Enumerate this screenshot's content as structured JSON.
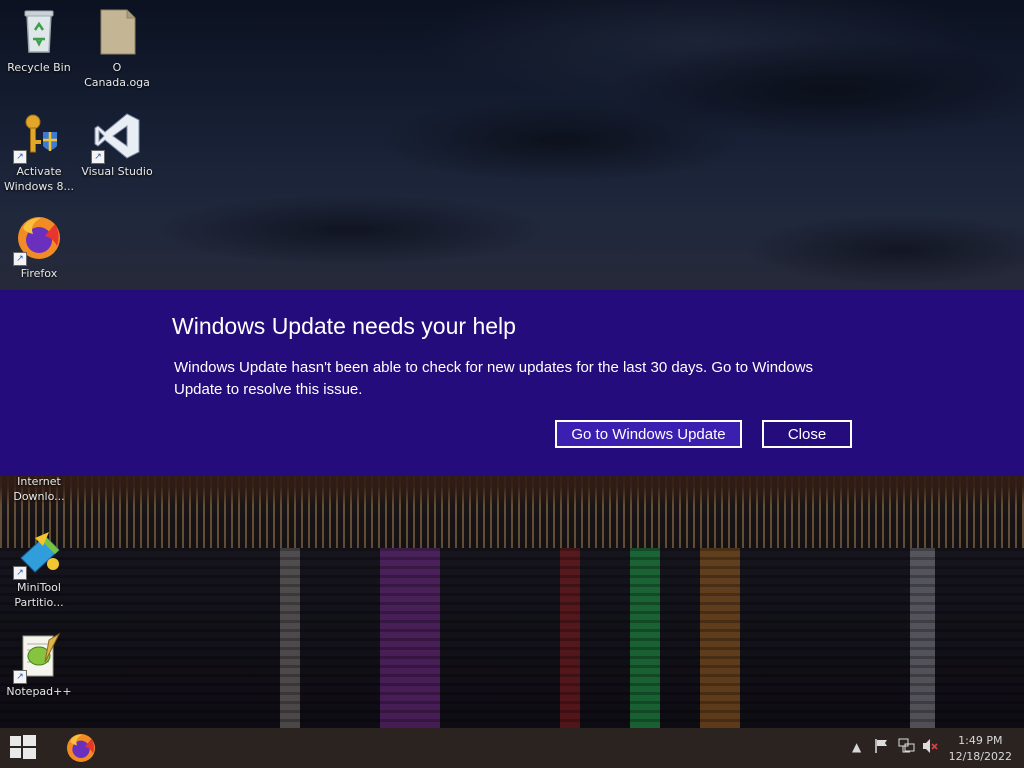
{
  "desktop": {
    "icons": [
      {
        "label": "Recycle Bin"
      },
      {
        "label": "O\nCanada.oga"
      },
      {
        "label": "Activate\nWindows 8..."
      },
      {
        "label": "Visual Studio"
      },
      {
        "label": "Firefox"
      },
      {
        "label": "Internet\nDownlo..."
      },
      {
        "label": "MiniTool\nPartitio..."
      },
      {
        "label": "Notepad++"
      }
    ]
  },
  "banner": {
    "title": "Windows Update needs your help",
    "body": "Windows Update hasn't been able to check for new updates for the last 30 days. Go to Windows Update to resolve this issue.",
    "primary_label": "Go to Windows Update",
    "close_label": "Close",
    "background_color": "#250c7c"
  },
  "taskbar": {
    "pinned": [
      "firefox-icon"
    ],
    "tray_icons": [
      "show-hidden-icons-chevron",
      "action-center-flag-icon",
      "network-icon",
      "volume-muted-icon"
    ],
    "clock": {
      "time": "1:49 PM",
      "date": "12/18/2022"
    }
  }
}
